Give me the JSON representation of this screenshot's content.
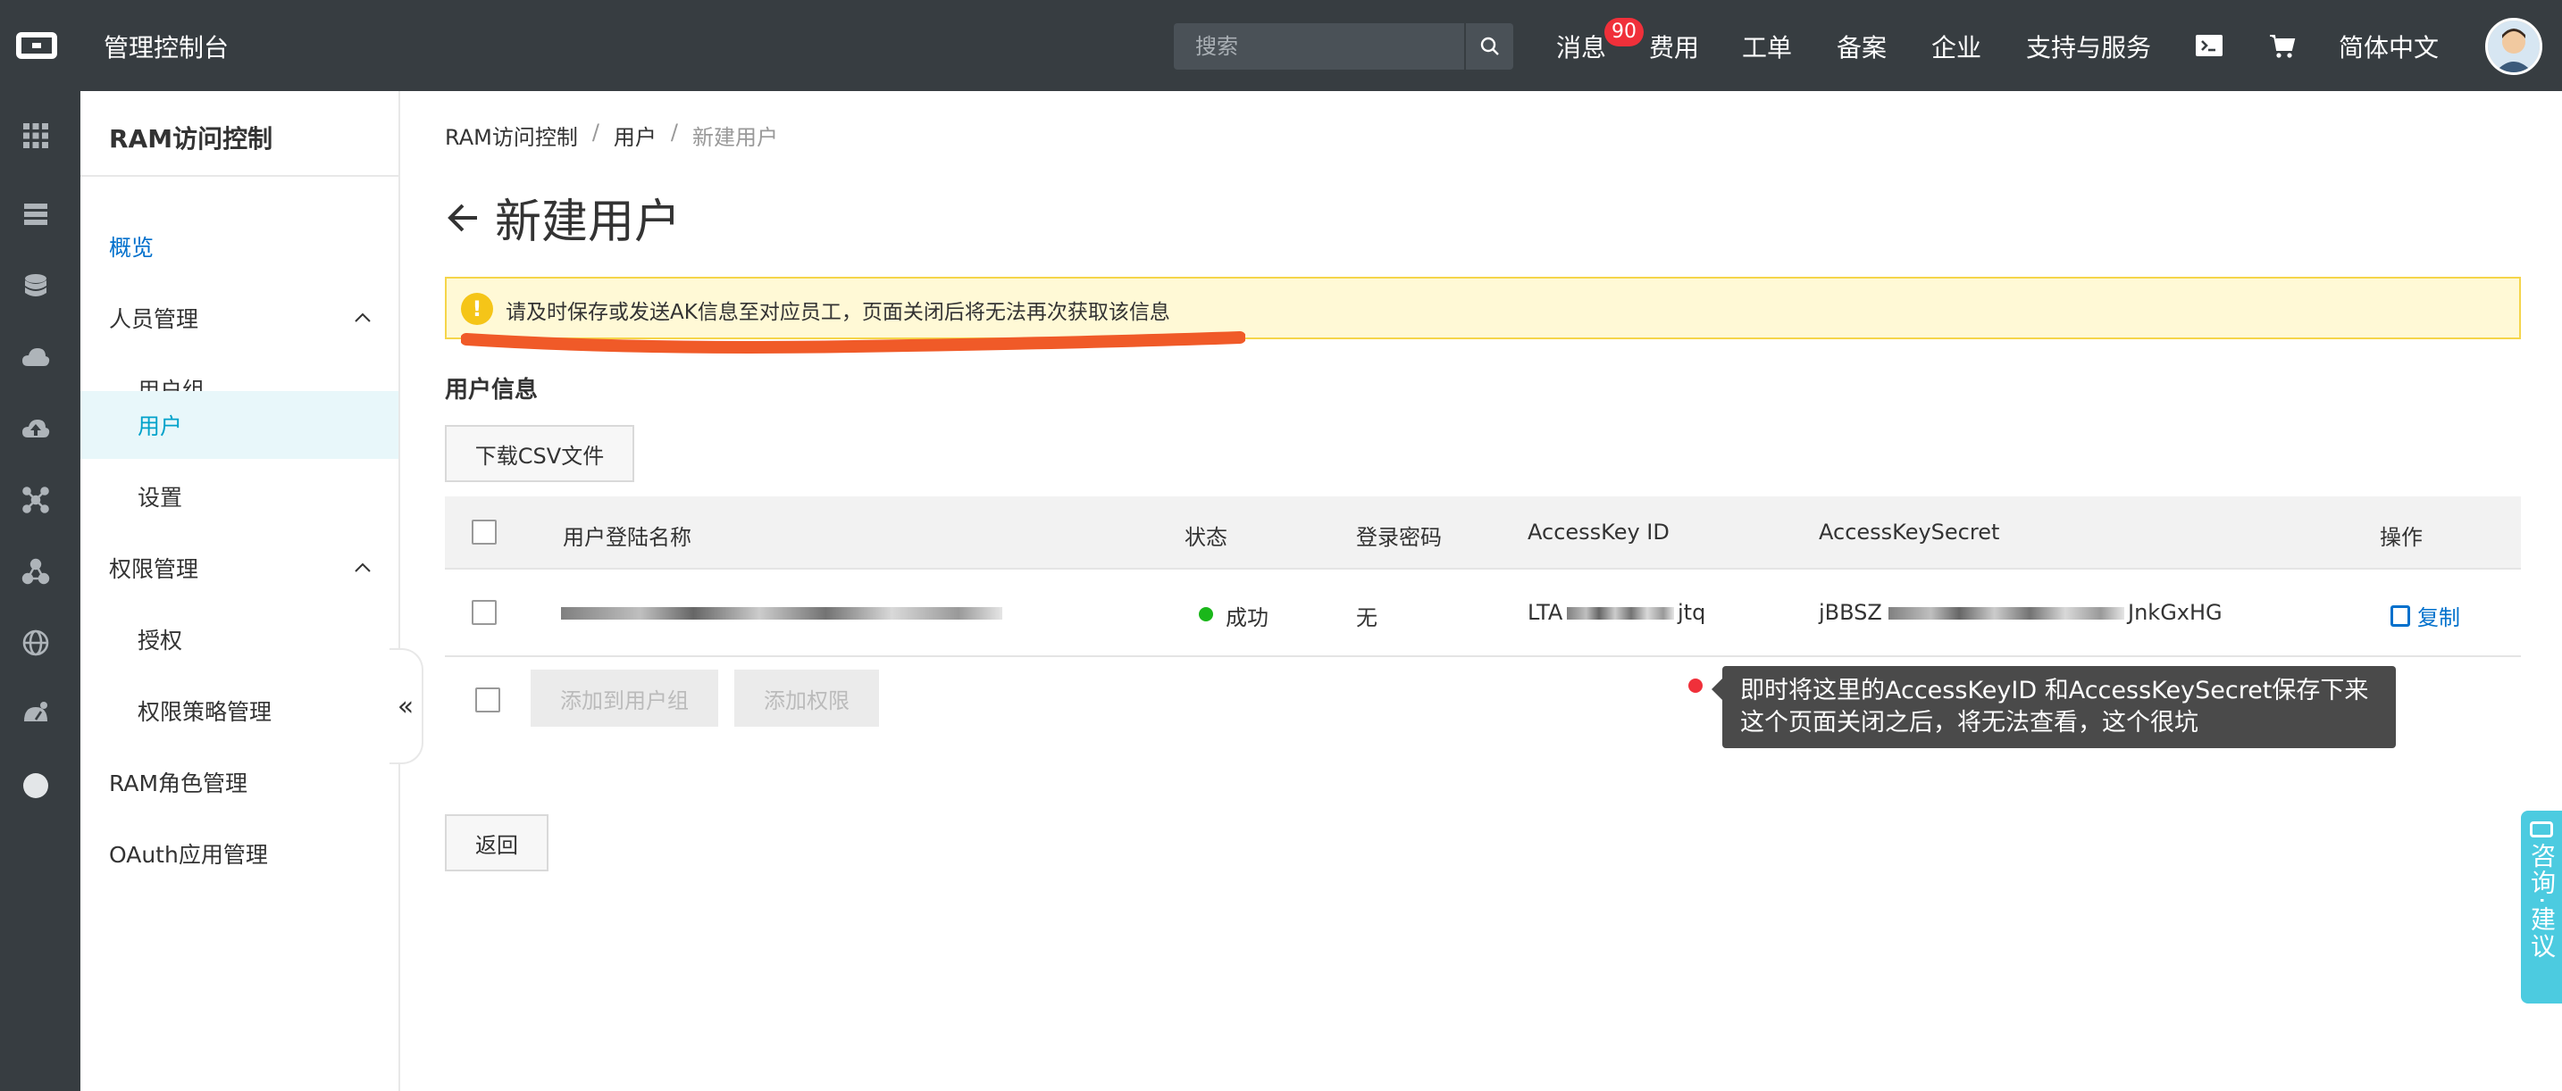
{
  "topbar": {
    "console_title": "管理控制台",
    "search_placeholder": "搜索",
    "messages_label": "消息",
    "messages_count": "90",
    "fees_label": "费用",
    "tickets_label": "工单",
    "filing_label": "备案",
    "enterprise_label": "企业",
    "support_label": "支持与服务",
    "language_label": "简体中文"
  },
  "sidebar": {
    "title": "RAM访问控制",
    "overview": "概览",
    "people_mgmt": "人员管理",
    "user_groups": "用户组",
    "users": "用户",
    "settings": "设置",
    "permission_mgmt": "权限管理",
    "authorization": "授权",
    "policy_mgmt": "权限策略管理",
    "role_mgmt": "RAM角色管理",
    "oauth_mgmt": "OAuth应用管理"
  },
  "breadcrumb": {
    "root": "RAM访问控制",
    "sep": "/",
    "users": "用户",
    "current": "新建用户"
  },
  "page": {
    "title": "新建用户",
    "alert": "请及时保存或发送AK信息至对应员工，页面关闭后将无法再次获取该信息",
    "section_title": "用户信息",
    "download_csv": "下载CSV文件",
    "back": "返回"
  },
  "table": {
    "headers": {
      "login_name": "用户登陆名称",
      "status": "状态",
      "password": "登录密码",
      "access_key_id": "AccessKey ID",
      "access_key_secret": "AccessKeySecret",
      "actions": "操作"
    },
    "row": {
      "status": "成功",
      "password": "无",
      "access_key_id_prefix": "LTA",
      "access_key_id_suffix": "jtq",
      "access_key_secret_prefix": "jBBSZ",
      "access_key_secret_suffix": "JnkGxHG",
      "copy": "复制"
    },
    "add_to_group": "添加到用户组",
    "add_permission": "添加权限"
  },
  "annotation": {
    "line1": "即时将这里的AccessKeyID 和AccessKeySecret保存下来",
    "line2": "这个页面关闭之后，将无法查看，这个很坑"
  },
  "consult": {
    "label": "咨询·建议"
  },
  "colors": {
    "topbar_bg": "#373d41",
    "accent": "#00a2ca",
    "link": "#0070cc",
    "alert_bg": "#fff9d6",
    "alert_border": "#f5d54a",
    "badge": "#f0303a",
    "success": "#1ab71a",
    "annotation_stroke": "#f05a28"
  }
}
